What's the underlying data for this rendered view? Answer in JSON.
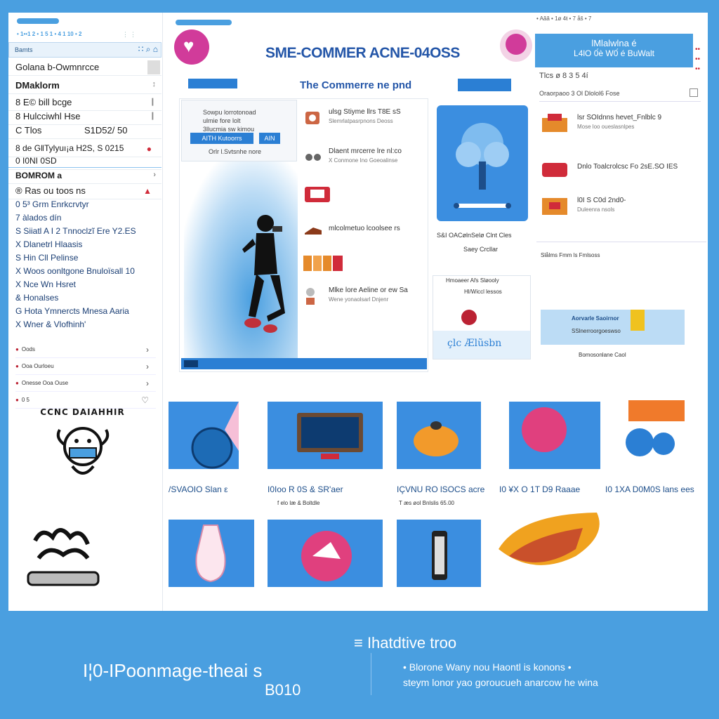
{
  "sidebar": {
    "top_prefix": "• 1••1 2 • 1 5 1 • 4 1 10 • 2",
    "search_placeholder": "Bamts",
    "search_icons": "∷ ⌕ ⌂",
    "rows": [
      {
        "label": "Golana b-Owmnrcce"
      },
      {
        "label": "DMaklorm"
      },
      {
        "label": "8 E© bill bcge"
      },
      {
        "label": "8 Hulcciwhl Hse"
      },
      {
        "label": "C Tlos",
        "value": "S1D52/ 50"
      },
      {
        "label": "8 de GǁTylyuı¡a H2S, S 0215"
      },
      {
        "label": "0 I0NI 0SD"
      },
      {
        "label": "BOMROM a"
      },
      {
        "label": "® Ras ou toos ns"
      }
    ],
    "list": [
      "0 5³ Grm Enrkcrvtyr",
      "7 àlados dín",
      "S Siiatl A I 2 Tnnoclzĩ Ere Y2.ES",
      "X Dlanetrl Hlaasis",
      "S Hin Cll Pelinse",
      "X Woos oonltgone Bnuloïsall 10",
      "X Nce Wn Hsret",
      "& Honalses",
      "G Hota Ymnercts Mnesa Aaria",
      "X Wner & Vlofhinh'"
    ],
    "small_rows": [
      {
        "label": "Oods"
      },
      {
        "label": "Ooa Ourloeu"
      },
      {
        "label": "Onesse Ooa Ouse"
      },
      {
        "label": "0 5"
      }
    ],
    "logo_text": "CCNC DAIAHHIR"
  },
  "header": {
    "title": "SME-COMMER ACNE-04OSS",
    "subtitle": "The Commerre ne pnd"
  },
  "hero_card": {
    "lines": [
      "Sowpu lorrotonoad",
      "ulmie fore lolt",
      "3llucmia sw kimou"
    ],
    "btn1": "AITH Kutoorrs",
    "btn2": "AIN",
    "caption": "Orlr l.Svtsnhe nore"
  },
  "mid_items": [
    {
      "title": "ulsg Stiyme llrs T8E sS",
      "sub": "Slemrlatpasrpnons Deoss"
    },
    {
      "title": "Dlaent mrcerre lre nl:co",
      "sub": "X Conmone Ino Goeoalinse"
    },
    {
      "title": "",
      "sub": ""
    },
    {
      "title": "mlcolmetuo lcoolsee rs",
      "sub": ""
    },
    {
      "title": "",
      "sub": ""
    },
    {
      "title": "Mlke lore Aeline or ew Sa",
      "sub": "Wene yonaolsarl Dnjenr"
    }
  ],
  "tree_card": {
    "cap1": "S&I OACølnSelø Clnt Cles",
    "cap2": "Saey Crcllar",
    "small_title": "Hmoaeer Ařs Sløooly",
    "small_sub": "Hl/Wiccl lessos",
    "small_bottom": "çlc Ælũsbn"
  },
  "right_col": {
    "top_text": "• Aăă • 1ø 4ŧ • 7 åš • 7",
    "head_l1": "lMlalwlna é",
    "head_l2": "L4lO 0́è W0́ é BuWalt",
    "dots": "••\n••\n••",
    "subhead": "Tlcs   ø 8 3   5 4í",
    "line": "Oraorpaoo      3 Ol Dlolol6 Fose",
    "items": [
      {
        "title": "lsr SOIdnns hevet_Fnlblc 9",
        "sub": "Mose loo oueslasnlpes"
      },
      {
        "title": "Dnlo Toalcrolcsc Fo 2sE.SO IES",
        "sub": ""
      },
      {
        "title": "l0I S C0d 2nd0-",
        "sub": "Duleenra nsols"
      }
    ],
    "strip_text": "Slålms  Fmm ls  Fmlsoss",
    "blue_title": "Aorvarle Saoirnor",
    "blue_sub": "SSlnerroorgoeswso",
    "blue_caption": "Bomosonlane Caol"
  },
  "tiles": [
    {
      "label": "/SVAOIO Slan ε",
      "sub": ""
    },
    {
      "label": "I0Ioo R 0S & SR'aer",
      "sub": "f elo læ & Boltdle"
    },
    {
      "label": "IÇVNU RO lSOCS acre",
      "sub": "T æs øol Bnlslis 65.00"
    },
    {
      "label": "I0 ¥X O 1T D9 Raaae",
      "sub": ""
    },
    {
      "label": "I0 1XA D0M0S lans ees",
      "sub": ""
    }
  ],
  "footer": {
    "title": "I¦0-IPoonmage-theai s",
    "title2": "B010",
    "tag": "≡ Ihatdtive troo",
    "desc1": "• Blorone Wany nou Haontl is konons •",
    "desc2": "steym lonor yao goroucueh anarcow he wina"
  },
  "colors": {
    "brand_blue": "#4a9fe0",
    "accent_blue": "#2b7fd4",
    "title_blue": "#2456a8",
    "heart_magenta": "#d13b9a",
    "alert_red": "#d02b3a"
  }
}
